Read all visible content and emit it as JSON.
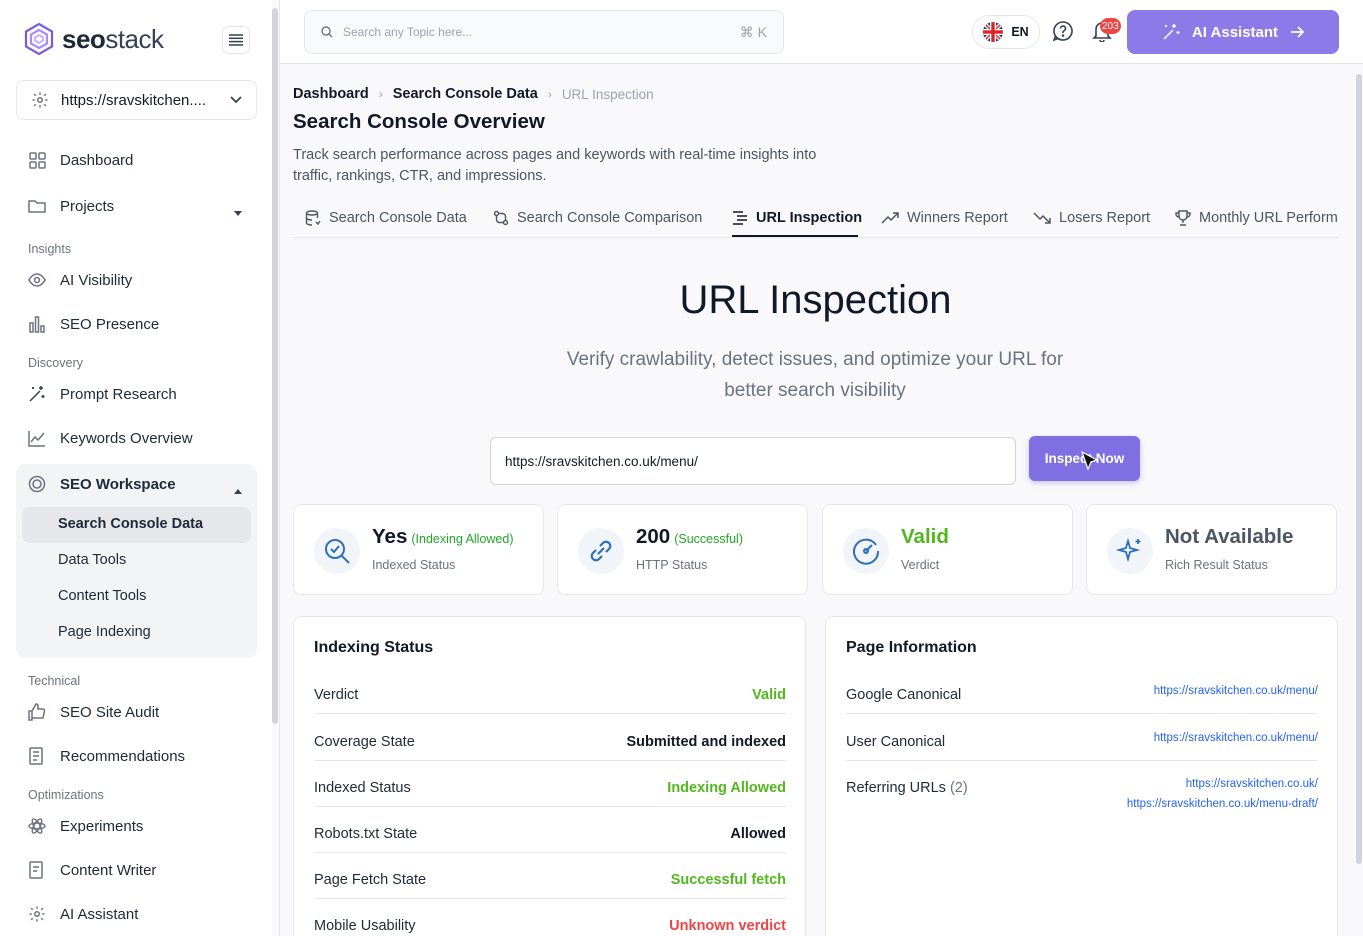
{
  "brand": {
    "name_a": "seo",
    "name_b": "stack"
  },
  "site": "https://sravskitchen....",
  "nav": {
    "dashboard": "Dashboard",
    "projects": "Projects",
    "sec_insights": "Insights",
    "ai_visibility": "AI Visibility",
    "seo_presence": "SEO Presence",
    "sec_discovery": "Discovery",
    "prompt_research": "Prompt Research",
    "keywords_overview": "Keywords Overview",
    "seo_workspace": "SEO Workspace",
    "sub": [
      "Search Console Data",
      "Data Tools",
      "Content Tools",
      "Page Indexing"
    ],
    "sec_technical": "Technical",
    "seo_site_audit": "SEO Site Audit",
    "recommendations": "Recommendations",
    "sec_optimizations": "Optimizations",
    "experiments": "Experiments",
    "content_writer": "Content Writer",
    "ai_assistant": "AI Assistant"
  },
  "topbar": {
    "search_placeholder": "Search any Topic here...",
    "shortcut": "⌘ K",
    "lang": "EN",
    "notif_count": "203",
    "ai_button": "AI Assistant"
  },
  "breadcrumb": [
    "Dashboard",
    "Search Console Data",
    "URL Inspection"
  ],
  "page": {
    "title": "Search Console Overview",
    "desc": "Track search performance across pages and keywords with real-time insights into traffic, rankings, CTR, and impressions."
  },
  "tabs": [
    "Search Console Data",
    "Search Console Comparison",
    "URL Inspection",
    "Winners Report",
    "Losers Report",
    "Monthly URL Perform"
  ],
  "hero": {
    "title": "URL Inspection",
    "subtitle": "Verify crawlability, detect issues, and optimize your URL for better search visibility"
  },
  "inspect": {
    "url": "https://sravskitchen.co.uk/menu/",
    "button": "Inspect Now"
  },
  "stats": [
    {
      "value": "Yes",
      "note": "(Indexing Allowed)",
      "label": "Indexed Status"
    },
    {
      "value": "200",
      "note": "(Successful)",
      "label": "HTTP Status"
    },
    {
      "value": "Valid",
      "note": "",
      "label": "Verdict"
    },
    {
      "value": "Not Available",
      "note": "",
      "label": "Rich Result Status"
    }
  ],
  "indexing": {
    "title": "Indexing Status",
    "rows": [
      {
        "k": "Verdict",
        "v": "Valid"
      },
      {
        "k": "Coverage State",
        "v": "Submitted and indexed"
      },
      {
        "k": "Indexed Status",
        "v": "Indexing Allowed"
      },
      {
        "k": "Robots.txt State",
        "v": "Allowed"
      },
      {
        "k": "Page Fetch State",
        "v": "Successful fetch"
      },
      {
        "k": "Mobile Usability",
        "v": "Unknown verdict"
      }
    ]
  },
  "pageinfo": {
    "title": "Page Information",
    "google_canonical_label": "Google Canonical",
    "google_canonical": "https://sravskitchen.co.uk/menu/",
    "user_canonical_label": "User Canonical",
    "user_canonical": "https://sravskitchen.co.uk/menu/",
    "referring_label": "Referring URLs",
    "referring_count": "(2)",
    "referring": [
      "https://sravskitchen.co.uk/",
      "https://sravskitchen.co.uk/menu-draft/"
    ]
  },
  "colors": {
    "accent": "#8b7ae8",
    "green": "#52b71e",
    "red": "#ef4444"
  }
}
